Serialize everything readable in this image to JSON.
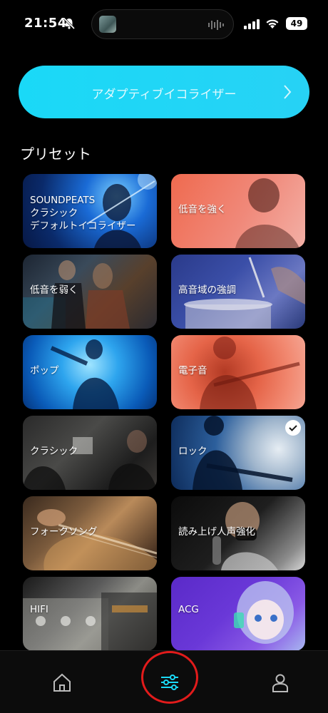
{
  "status_bar": {
    "time": "21:54",
    "battery": "49"
  },
  "adaptive_eq": {
    "label": "アダプティブイコライザー"
  },
  "presets": {
    "title": "プリセット",
    "items": [
      {
        "label_lines": [
          "SOUNDPEATS",
          "クラシック",
          "デフォルトイコライザー"
        ]
      },
      {
        "label": "低音を強く"
      },
      {
        "label": "低音を弱く"
      },
      {
        "label": "高音域の強調"
      },
      {
        "label": "ポップ"
      },
      {
        "label": "電子音"
      },
      {
        "label": "クラシック"
      },
      {
        "label": "ロック",
        "selected": true
      },
      {
        "label": "フォークソング"
      },
      {
        "label": "読み上げ人声強化"
      },
      {
        "label": "HIFI"
      },
      {
        "label": "ACG"
      }
    ]
  },
  "colors": {
    "accent": "#1ad9f7",
    "highlight_ring": "#e21b1b"
  },
  "bottom_nav": {
    "items": [
      "home-icon",
      "equalizer-icon",
      "profile-icon"
    ],
    "active": "equalizer-icon"
  }
}
